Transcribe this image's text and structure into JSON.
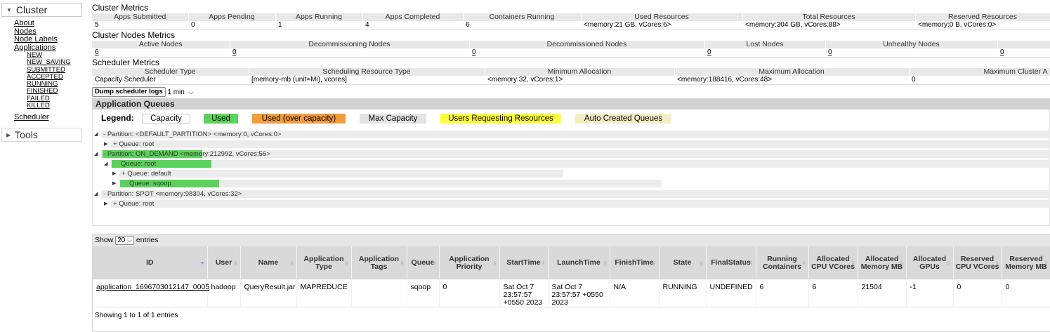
{
  "nav": {
    "cluster_title": "Cluster",
    "links": [
      "About",
      "Nodes",
      "Node Labels",
      "Applications"
    ],
    "app_states": [
      "NEW",
      "NEW_SAVING",
      "SUBMITTED",
      "ACCEPTED",
      "RUNNING",
      "FINISHED",
      "FAILED",
      "KILLED"
    ],
    "scheduler": "Scheduler",
    "tools_title": "Tools"
  },
  "cluster_metrics": {
    "title": "Cluster Metrics",
    "headers": [
      "Apps Submitted",
      "Apps Pending",
      "Apps Running",
      "Apps Completed",
      "Containers Running",
      "Used Resources",
      "Total Resources",
      "Reserved Resources"
    ],
    "values": [
      "5",
      "0",
      "1",
      "4",
      "6",
      "<memory:21 GB, vCores:6>",
      "<memory:304 GB, vCores:88>",
      "<memory:0 B, vCores:0>"
    ]
  },
  "node_metrics": {
    "title": "Cluster Nodes Metrics",
    "headers": [
      "Active Nodes",
      "Decommissioning Nodes",
      "Decommissioned Nodes",
      "Lost Nodes",
      "Unhealthy Nodes",
      ""
    ],
    "values": [
      "6",
      "0",
      "0",
      "0",
      "0",
      "0"
    ]
  },
  "scheduler_metrics": {
    "title": "Scheduler Metrics",
    "headers": [
      "Scheduler Type",
      "Scheduling Resource Type",
      "Minimum Allocation",
      "Maximum Allocation",
      "Maximum Cluster A"
    ],
    "values": [
      "Capacity Scheduler",
      "[memory-mb (unit=Mi), vcores]",
      "<memory:32, vCores:1>",
      "<memory:188416, vCores:48>",
      "0"
    ]
  },
  "dump": {
    "button": "Dump scheduler logs",
    "interval": "1 min"
  },
  "queues": {
    "title": "Application Queues",
    "legend_title": "Legend:",
    "legend": {
      "capacity": "Capacity",
      "used": "Used",
      "over": "Used (over capacity)",
      "max": "Max Capacity",
      "users": "Users Requesting Resources",
      "auto": "Auto Created Queues"
    },
    "colors": {
      "used": "#5bd25b",
      "over": "#f39c3a",
      "max": "#e3e3e3",
      "users": "#ffff3a",
      "auto": "#f3eec5"
    },
    "rows": [
      {
        "toggle": "- ",
        "label": "Partition: <DEFAULT_PARTITION> <memory:0, vCores:0>"
      },
      {
        "toggle": "+ ",
        "label": "Queue: root"
      },
      {
        "toggle": "- ",
        "label": "Partition: ON_DEMAND <memory:212992, vCores:56>"
      },
      {
        "toggle": "",
        "label": "Queue: root"
      },
      {
        "toggle": "+ ",
        "label": "Queue: default"
      },
      {
        "toggle": "",
        "label": "Queue: sqoop"
      },
      {
        "toggle": "- ",
        "label": "Partition: SPOT <memory:98304, vCores:32>"
      },
      {
        "toggle": "+ ",
        "label": "Queue: root"
      }
    ]
  },
  "apps": {
    "show": "Show",
    "page_size": "20",
    "entries": "entries",
    "columns": [
      "ID",
      "User",
      "Name",
      "Application Type",
      "Application Tags",
      "Queue",
      "Application Priority",
      "StartTime",
      "LaunchTime",
      "FinishTime",
      "State",
      "FinalStatus",
      "Running Containers",
      "Allocated CPU VCores",
      "Allocated Memory MB",
      "Allocated GPUs",
      "Reserved CPU VCores",
      "Reserved Memory MB"
    ],
    "row": [
      "application_1696703012147_0005",
      "hadoop",
      "QueryResult.jar",
      "MAPREDUCE",
      "",
      "sqoop",
      "0",
      "Sat Oct 7 23:57:57 +0550 2023",
      "Sat Oct 7 23:57:57 +0550 2023",
      "N/A",
      "RUNNING",
      "UNDEFINED",
      "6",
      "6",
      "21504",
      "-1",
      "0",
      "0"
    ],
    "footer": "Showing 1 to 1 of 1 entries"
  }
}
